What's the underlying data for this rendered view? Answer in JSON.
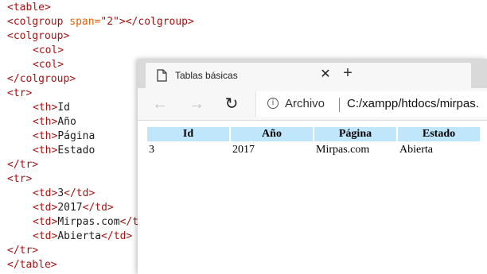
{
  "editor": {
    "lines": [
      {
        "indent": false,
        "parts": [
          {
            "t": "tag",
            "v": "<table>"
          }
        ]
      },
      {
        "indent": false,
        "parts": [
          {
            "t": "tag",
            "v": "<colgroup "
          },
          {
            "t": "attr",
            "v": "span="
          },
          {
            "t": "val",
            "v": "\"2\""
          },
          {
            "t": "tag",
            "v": "></colgroup>"
          }
        ]
      },
      {
        "indent": false,
        "parts": [
          {
            "t": "tag",
            "v": "<colgroup>"
          }
        ]
      },
      {
        "indent": true,
        "parts": [
          {
            "t": "tag",
            "v": "<col>"
          }
        ]
      },
      {
        "indent": true,
        "parts": [
          {
            "t": "tag",
            "v": "<col>"
          }
        ]
      },
      {
        "indent": false,
        "parts": [
          {
            "t": "tag",
            "v": "</colgroup>"
          }
        ]
      },
      {
        "indent": false,
        "parts": [
          {
            "t": "tag",
            "v": "<tr>"
          }
        ]
      },
      {
        "indent": true,
        "parts": [
          {
            "t": "tag",
            "v": "<th>"
          },
          {
            "t": "txt",
            "v": "Id"
          }
        ]
      },
      {
        "indent": true,
        "parts": [
          {
            "t": "tag",
            "v": "<th>"
          },
          {
            "t": "txt",
            "v": "Año"
          }
        ]
      },
      {
        "indent": true,
        "parts": [
          {
            "t": "tag",
            "v": "<th>"
          },
          {
            "t": "txt",
            "v": "Página"
          }
        ]
      },
      {
        "indent": true,
        "parts": [
          {
            "t": "tag",
            "v": "<th>"
          },
          {
            "t": "txt",
            "v": "Estado"
          }
        ]
      },
      {
        "indent": false,
        "parts": [
          {
            "t": "tag",
            "v": "</tr>"
          }
        ]
      },
      {
        "indent": false,
        "parts": [
          {
            "t": "tag",
            "v": "<tr>"
          }
        ]
      },
      {
        "indent": true,
        "parts": [
          {
            "t": "tag",
            "v": "<td>"
          },
          {
            "t": "txt",
            "v": "3"
          },
          {
            "t": "tag",
            "v": "</td>"
          }
        ]
      },
      {
        "indent": true,
        "parts": [
          {
            "t": "tag",
            "v": "<td>"
          },
          {
            "t": "txt",
            "v": "2017"
          },
          {
            "t": "tag",
            "v": "</td>"
          }
        ]
      },
      {
        "indent": true,
        "parts": [
          {
            "t": "tag",
            "v": "<td>"
          },
          {
            "t": "txt",
            "v": "Mirpas.com"
          },
          {
            "t": "tag",
            "v": "</td>"
          }
        ]
      },
      {
        "indent": true,
        "parts": [
          {
            "t": "tag",
            "v": "<td>"
          },
          {
            "t": "txt",
            "v": "Abierta"
          },
          {
            "t": "tag",
            "v": "</td>"
          }
        ]
      },
      {
        "indent": false,
        "parts": [
          {
            "t": "tag",
            "v": "</tr>"
          }
        ]
      },
      {
        "indent": false,
        "parts": [
          {
            "t": "tag",
            "v": "</table>"
          }
        ]
      }
    ]
  },
  "browser": {
    "tab_title": "Tablas básicas",
    "tab_close_icon": "close-icon",
    "new_tab_icon": "plus-icon",
    "back_icon": "arrow-left-icon",
    "forward_icon": "arrow-right-icon",
    "reload_icon": "reload-icon",
    "info_icon": "info-icon",
    "address_label": "Archivo",
    "address_url": "C:/xampp/htdocs/mirpas.",
    "colors": {
      "header_bg": "#bfe6fb",
      "tabstrip": "#d9d9d9"
    }
  },
  "page": {
    "headers": [
      "Id",
      "Año",
      "Página",
      "Estado"
    ],
    "rows": [
      [
        "3",
        "2017",
        "Mirpas.com",
        "Abierta"
      ]
    ]
  }
}
